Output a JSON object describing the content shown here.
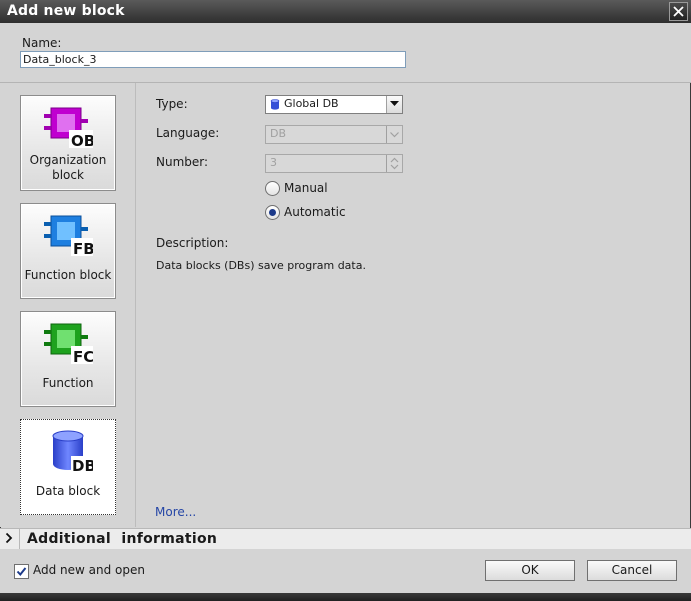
{
  "window": {
    "title": "Add new block",
    "close_icon": "close-icon"
  },
  "name": {
    "label": "Name:",
    "value": "Data_block_3"
  },
  "blocks": [
    {
      "id": "OB",
      "label_line1": "Organization",
      "label_line2": "block",
      "badge": "OB",
      "color": "#b000c0",
      "icon": "organization-block-icon"
    },
    {
      "id": "FB",
      "label_line1": "Function block",
      "badge": "FB",
      "color": "#1f7fe0",
      "icon": "function-block-icon"
    },
    {
      "id": "FC",
      "label_line1": "Function",
      "badge": "FC",
      "color": "#1ea21e",
      "icon": "function-icon"
    },
    {
      "id": "DB",
      "label_line1": "Data block",
      "badge": "DB",
      "color": "#3550d8",
      "icon": "data-block-icon",
      "selected": true
    }
  ],
  "form": {
    "type_label": "Type:",
    "type_value": "Global DB",
    "language_label": "Language:",
    "language_value": "DB",
    "number_label": "Number:",
    "number_value": "3",
    "manual_label": "Manual",
    "automatic_label": "Automatic",
    "selected_mode": "Automatic",
    "description_label": "Description:",
    "description_text": "Data blocks (DBs) save program data.",
    "more_link": "More..."
  },
  "additional": {
    "label": "Additional  information"
  },
  "footer": {
    "add_open_label": "Add new and open",
    "add_open_checked": true,
    "ok_label": "OK",
    "cancel_label": "Cancel"
  }
}
